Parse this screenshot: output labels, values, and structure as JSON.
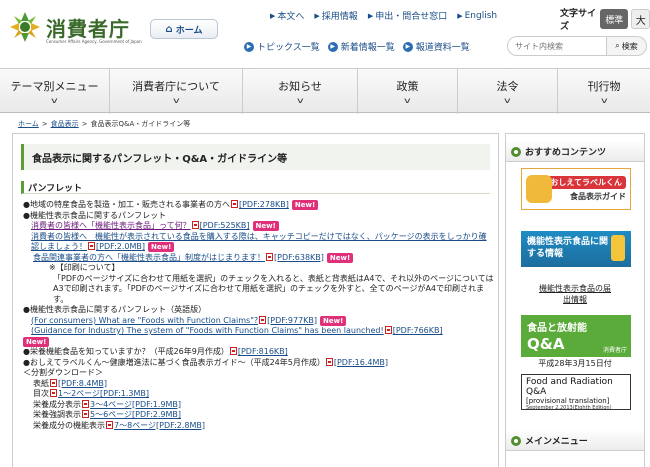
{
  "header": {
    "logo_text": "消費者庁",
    "logo_sub": "Consumer Affairs Agency, Government of Japan",
    "home_label": "ホーム",
    "util_nav": [
      "本文へ",
      "採用情報",
      "申出・問合せ窓口",
      "English"
    ],
    "font_size_label": "文字サイズ",
    "font_std": "標準",
    "font_big": "大",
    "sub_nav": [
      "トピックス一覧",
      "新着情報一覧",
      "報道資料一覧"
    ],
    "search_placeholder": "サイト内検索",
    "search_button": "検索"
  },
  "main_nav": [
    "テーマ別メニュー",
    "消費者庁について",
    "お知らせ",
    "政策",
    "法令",
    "刊行物"
  ],
  "breadcrumb": [
    "ホーム",
    "食品表示",
    "食品表示Q&A・ガイドライン等"
  ],
  "page_title": "食品表示に関するパンフレット・Q&A・ガイドライン等",
  "section_title": "パンフレット",
  "items": {
    "l1_text": "●地域の特産食品を製造・加工・販売される事業者の方へ",
    "l1_pdf": "[PDF:278KB]",
    "new": "New!",
    "l2_text": "●機能性表示食品に関するパンフレット",
    "l3_link": "消費者の皆様へ「機能性表示食品」って何？",
    "l3_pdf": "[PDF:525KB]",
    "l4_text": "消費者の皆様へ　機能性が表示されている食品を購入する際は、キャッチコピーだけではなく、パッケージの表示をしっかり確",
    "l5_text": "認しましょう！",
    "l5_pdf": "[PDF:2.0MB]",
    "l6_text": "食品関連事業者の方へ「機能性表示食品」制度がはじまります！",
    "l6_pdf": "[PDF:638KB]",
    "l7_text": "※【印刷について】",
    "l8_text": "「PDFのページサイズに合わせて用紙を選択」のチェックを入れると、表紙と背表紙はA4で、それ以外のページについては",
    "l9_text": "A3で印刷されます。「PDFのページサイズに合わせて用紙を選択」のチェックを外すと、全てのページがA4で印刷されま",
    "l10_text": "す。",
    "l11_text": "●機能性表示食品に関するパンフレット（英語版）",
    "l12_link": "(For consumers) What are \"Foods with Function Claims\"?",
    "l12_pdf": "[PDF:977KB]",
    "l13_link": "(Guidance for Industry) The system of \"Foods with Function Claims\" has been launched!",
    "l13_pdf": "[PDF:766KB]",
    "l15_text": "●栄養機能食品を知っていますか？（平成26年9月作成）",
    "l15_pdf": "[PDF:816KB]",
    "l16_text": "●おしえてラベルくん～健康増進法に基づく食品表示ガイド～（平成24年5月作成）",
    "l16_pdf": "[PDF:16.4MB]",
    "l17_text": "＜分割ダウンロード＞",
    "l18_text": "表紙",
    "l18_pdf": "[PDF:8.4MB]",
    "l19_text": "目次",
    "l19_link": "1～2ページ[PDF:1.3MB]",
    "l20_text": "栄養成分表示",
    "l20_link": "3～4ページ[PDF:1.9MB]",
    "l21_text": "栄養強調表示",
    "l21_link": "5～6ページ[PDF:2.9MB]",
    "l22_text": "栄養成分の機能表示",
    "l22_link": "7～8ページ[PDF:2.8MB]"
  },
  "sidebar": {
    "recommend_head": "おすすめコンテンツ",
    "banner1_a": "おしえてラベルくん",
    "banner1_b": "食品表示ガイド",
    "banner2": "機能性表示食品に関する情報",
    "link1": "機能性表示食品の届出情報",
    "banner3_a": "食品と放射能",
    "banner3_b": "Q&A",
    "banner3_c": "消費者庁",
    "date": "平成28年3月15日付",
    "banner4_a": "Food and Radiation Q&A",
    "banner4_b": "[provisional translation]",
    "banner4_c": "September 2.2013(Eighth Edition)",
    "menu_head": "メインメニュー"
  }
}
